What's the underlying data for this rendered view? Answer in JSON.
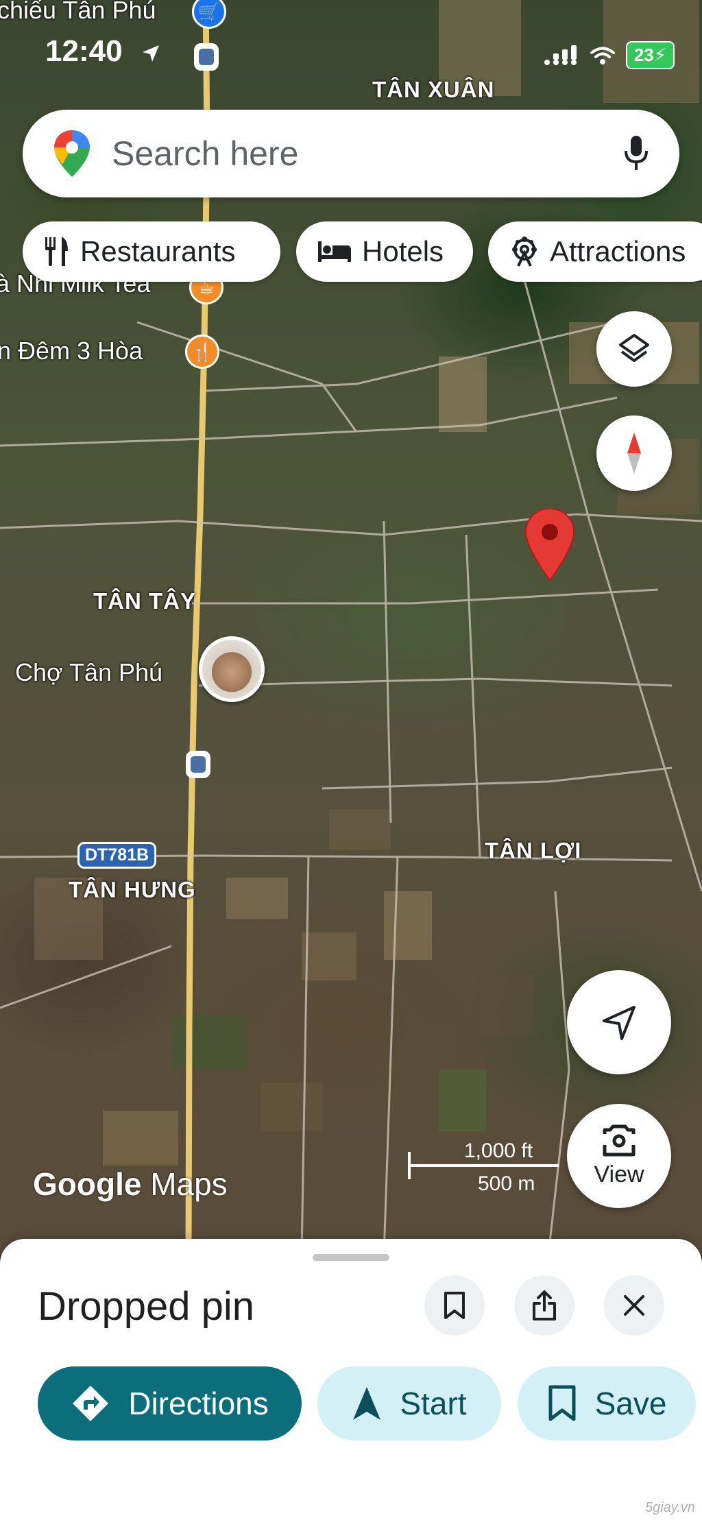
{
  "status_bar": {
    "time": "12:40",
    "battery": "23"
  },
  "search": {
    "placeholder": "Search here"
  },
  "chips": [
    {
      "label": "Restaurants",
      "icon": "fork-knife-icon"
    },
    {
      "label": "Hotels",
      "icon": "bed-icon"
    },
    {
      "label": "Attractions",
      "icon": "ferris-wheel-icon"
    }
  ],
  "map": {
    "labels": {
      "tan_xuan": "TÂN XUÂN",
      "tan_tay": "TÂN TÂY",
      "tan_loi": "TÂN LỢI",
      "tan_hung": "TÂN HƯNG"
    },
    "pois": {
      "top_cut": "chiếu Tân Phú",
      "milk_tea": "à Nhi Milk Tea",
      "dem_3_hoa": "n Đêm 3 Hòa",
      "market": "Chợ Tân Phú"
    },
    "route_shield": "DT781B",
    "attribution": {
      "google": "Google",
      "maps": "Maps"
    },
    "scale": {
      "imperial": "1,000 ft",
      "metric": "500 m"
    },
    "view_button": "View"
  },
  "sheet": {
    "title": "Dropped pin",
    "actions": {
      "directions": "Directions",
      "start": "Start",
      "save": "Save"
    }
  },
  "watermark": "5giay.vn",
  "colors": {
    "primary_teal": "#0b6e7a",
    "light_teal": "#d4f0f7",
    "pin_red": "#e53935",
    "poi_orange": "#f28c28"
  }
}
